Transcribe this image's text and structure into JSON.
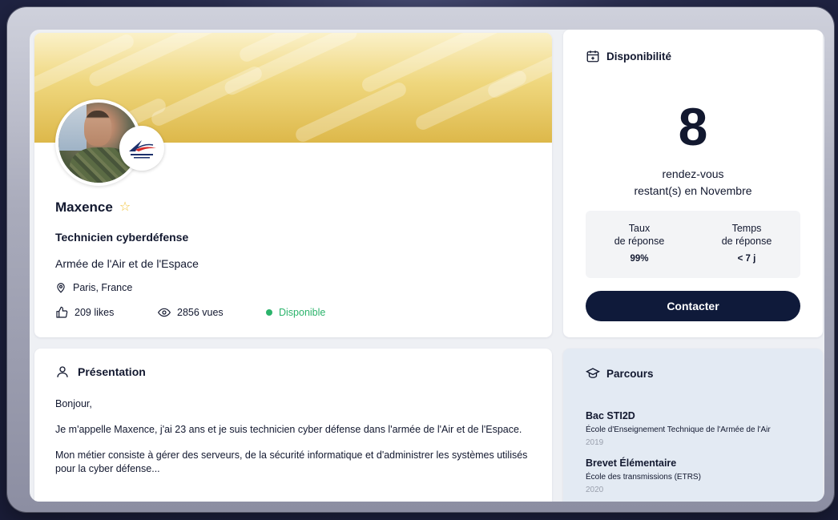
{
  "profile": {
    "name": "Maxence",
    "job_title": "Technicien cyberdéfense",
    "organization": "Armée de l'Air et de l'Espace",
    "location": "Paris, France",
    "likes": "209 likes",
    "views": "2856 vues",
    "status": "Disponible",
    "badge_logo_text": "ARMÉE DE L'AIR ET DE L'ESPACE"
  },
  "availability": {
    "title": "Disponibilité",
    "count": "8",
    "desc_line1": "rendez-vous",
    "desc_line2": "restant(s) en Novembre",
    "response_rate_label1": "Taux",
    "response_rate_label2": "de réponse",
    "response_rate_value": "99%",
    "response_time_label1": "Temps",
    "response_time_label2": "de réponse",
    "response_time_value": "< 7 j",
    "contact_label": "Contacter"
  },
  "presentation": {
    "title": "Présentation",
    "paragraphs": [
      "Bonjour,",
      "Je m'appelle Maxence, j'ai 23 ans et je suis technicien cyber défense dans l'armée de l'Air et de l'Espace.",
      "Mon métier consiste à gérer des serveurs, de la sécurité informatique et d'administrer les systèmes utilisés pour la cyber défense..."
    ]
  },
  "parcours": {
    "title": "Parcours",
    "items": [
      {
        "degree": "Bac STI2D",
        "school": "École d'Enseignement Technique de l'Armée de l'Air",
        "year": "2019"
      },
      {
        "degree": "Brevet Élémentaire",
        "school": "École des transmissions (ETRS)",
        "year": "2020"
      }
    ]
  },
  "colors": {
    "navy": "#0f1a3a",
    "status_green": "#2bb36b",
    "star_yellow": "#f1c232",
    "banner_gold": "#ddb84a"
  },
  "icons": [
    "calendar-plus-icon",
    "map-pin-icon",
    "thumbs-up-icon",
    "eye-icon",
    "user-icon",
    "graduation-cap-icon",
    "star-outline-icon"
  ]
}
